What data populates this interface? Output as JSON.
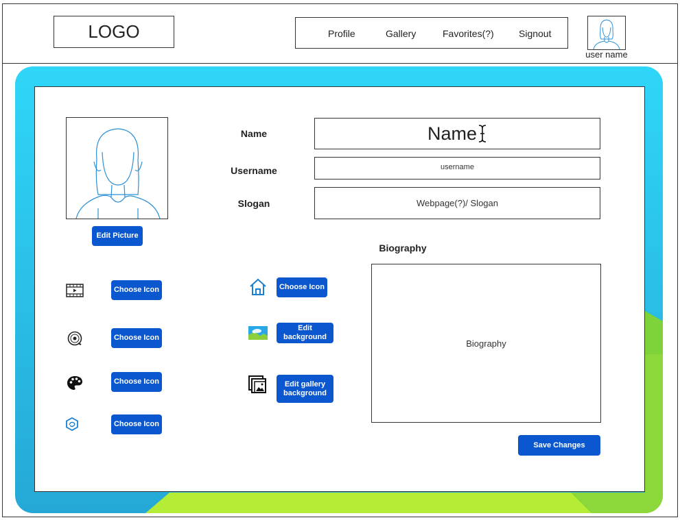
{
  "header": {
    "logo": "LOGO",
    "nav": [
      "Profile",
      "Gallery",
      "Favorites(?)",
      "Signout"
    ],
    "user_name": "user name"
  },
  "profile": {
    "edit_picture_label": "Edit Picture",
    "fields": {
      "name_label": "Name",
      "name_value": "Name",
      "username_label": "Username",
      "username_value": "username",
      "slogan_label": "Slogan",
      "slogan_value": "Webpage(?)/ Slogan"
    },
    "biography": {
      "label": "Biography",
      "value": "Biography"
    },
    "left_icon_buttons": [
      {
        "icon": "film-icon",
        "label": "Choose Icon"
      },
      {
        "icon": "vinyl-record-icon",
        "label": "Choose Icon"
      },
      {
        "icon": "palette-icon",
        "label": "Choose Icon"
      },
      {
        "icon": "hexagon-badge-icon",
        "label": "Choose Icon"
      }
    ],
    "middle_buttons": [
      {
        "icon": "home-icon",
        "label": "Choose Icon"
      },
      {
        "icon": "landscape-image-icon",
        "label": "Edit background"
      },
      {
        "icon": "gallery-stack-icon",
        "label": "Edit gallery background"
      }
    ],
    "save_label": "Save Changes"
  },
  "colors": {
    "accent_blue": "#0b57d0",
    "panel_cyan": "#2fd3f6",
    "panel_green": "#b5ec35",
    "avatar_stroke": "#2b8fd6"
  }
}
